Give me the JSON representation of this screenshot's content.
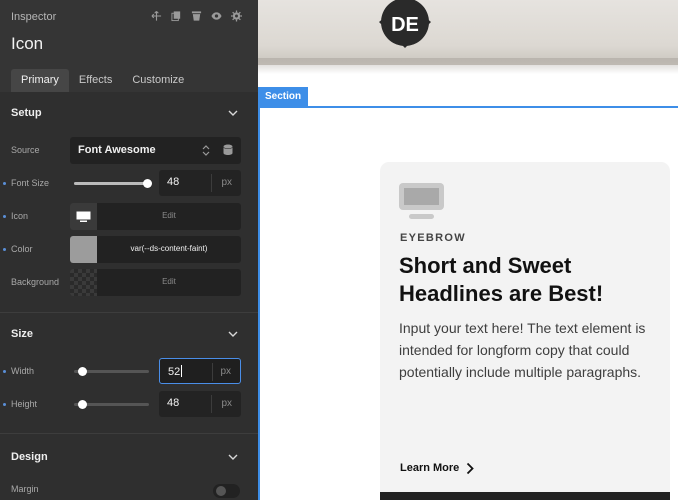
{
  "inspector": {
    "label": "Inspector",
    "title": "Icon",
    "tools": [
      "move-icon",
      "copy-icon",
      "delete-icon",
      "visibility-icon",
      "settings-icon"
    ],
    "tabs": [
      {
        "label": "Primary",
        "active": true
      },
      {
        "label": "Effects",
        "active": false
      },
      {
        "label": "Customize",
        "active": false
      }
    ],
    "setup": {
      "title": "Setup",
      "source_label": "Source",
      "source_value": "Font Awesome",
      "font_size_label": "Font Size",
      "font_size_value": "48",
      "font_size_unit": "px",
      "font_size_slider": 0.97,
      "icon_label": "Icon",
      "icon_edit": "Edit",
      "color_label": "Color",
      "color_value": "var(--ds-content-faint)",
      "background_label": "Background",
      "background_edit": "Edit"
    },
    "size": {
      "title": "Size",
      "width_label": "Width",
      "width_value": "52",
      "width_unit": "px",
      "width_slider": 0.0,
      "height_label": "Height",
      "height_value": "48",
      "height_unit": "px",
      "height_slider": 0.0
    },
    "design": {
      "title": "Design",
      "margin_label": "Margin"
    }
  },
  "canvas": {
    "section_label": "Section",
    "logo_text": "DE",
    "card": {
      "eyebrow": "EYEBROW",
      "headline": "Short and Sweet Headlines are Best!",
      "body": "Input your text here! The text element is intended for longform copy that could potentially include multiple paragraphs.",
      "link": "Learn More"
    }
  },
  "colors": {
    "panel_bg": "#2f2f2f",
    "accent": "#3d8ee8",
    "color_swatch": "#9c9c9c",
    "card_bg": "#f3f3f3"
  }
}
